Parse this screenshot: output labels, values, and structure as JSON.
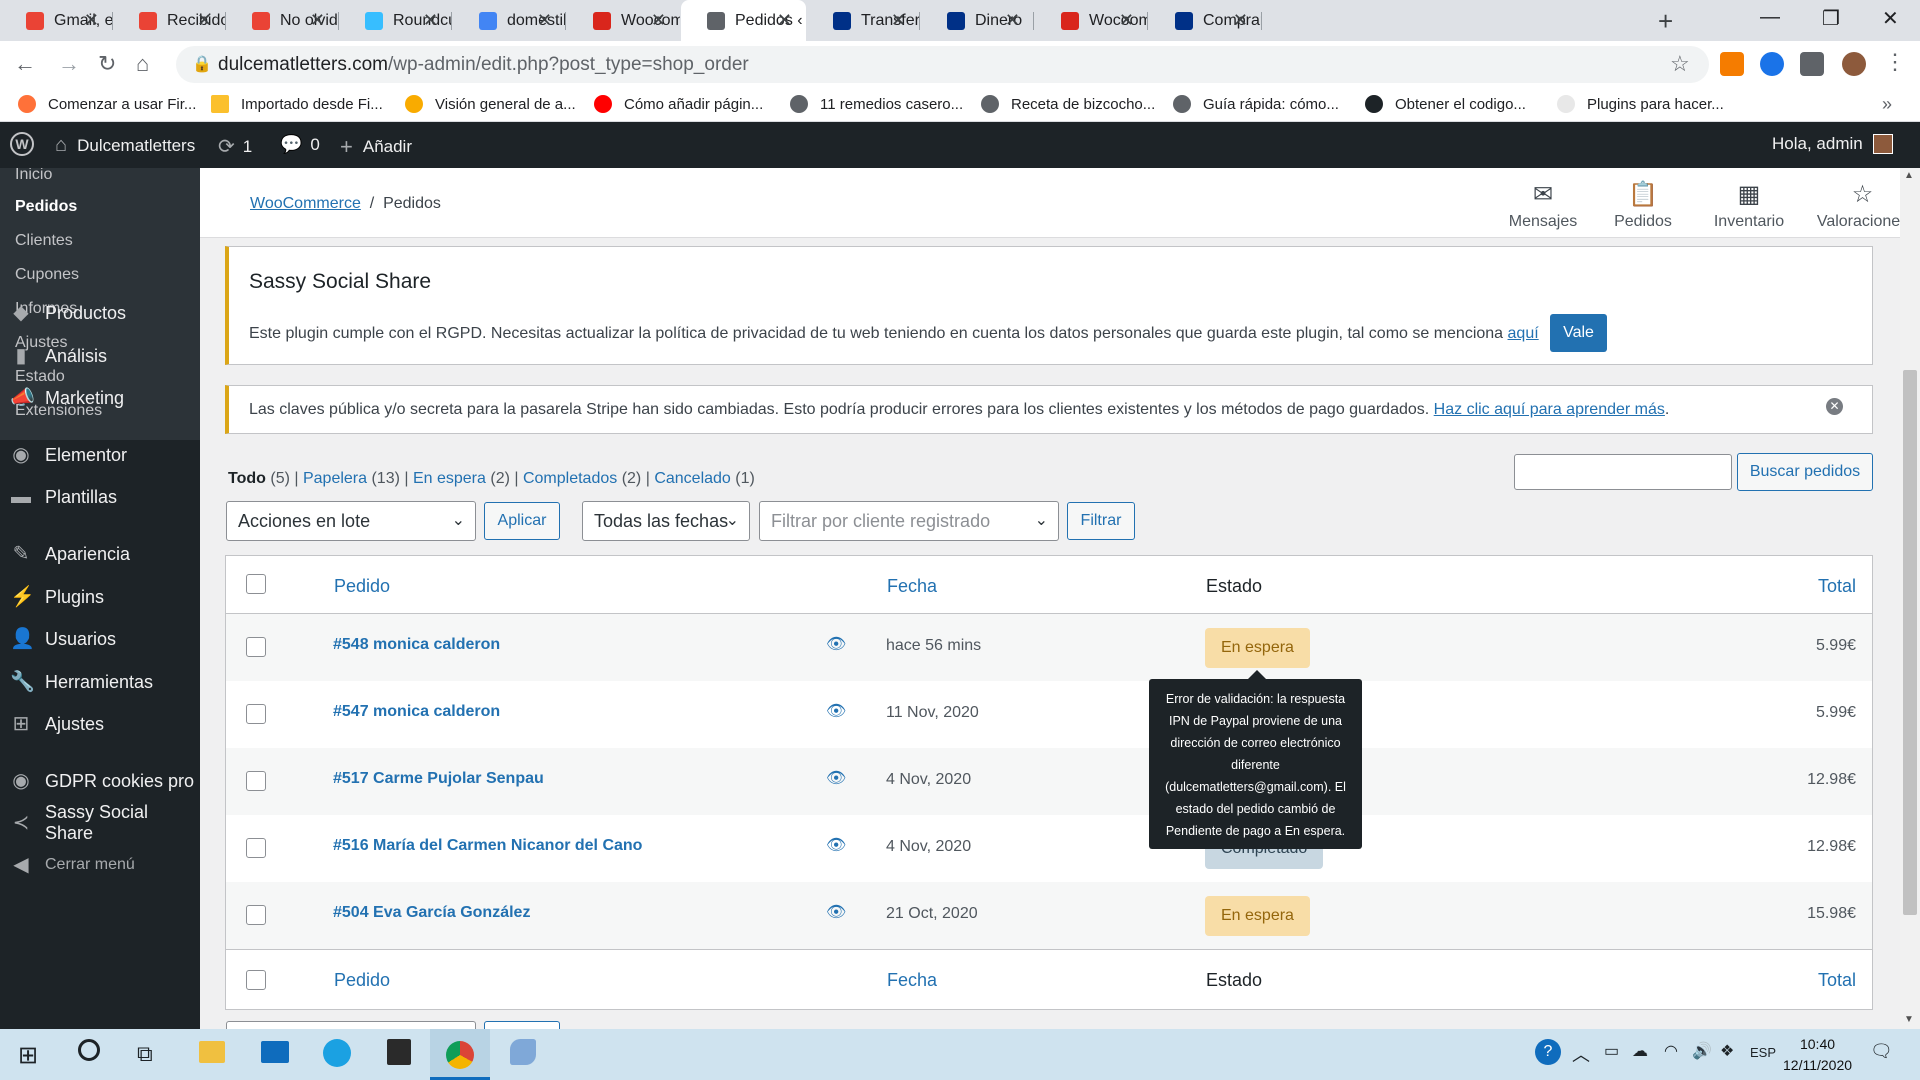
{
  "browser": {
    "tabs": [
      {
        "label": "Gmail, el c",
        "icon": "gmail-icon",
        "color": "#ea4335"
      },
      {
        "label": "Recibidos",
        "icon": "gmail-icon",
        "color": "#ea4335"
      },
      {
        "label": "No olvide",
        "icon": "gmail-icon",
        "color": "#ea4335"
      },
      {
        "label": "Roundcub",
        "icon": "roundcube-icon",
        "color": "#37beff"
      },
      {
        "label": "domestika",
        "icon": "google-icon",
        "color": "#4285f4"
      },
      {
        "label": "Woocomm",
        "icon": "woocommerce-icon",
        "color": "#d9261c"
      },
      {
        "label": "Pedidos ‹",
        "icon": "page-icon",
        "color": "#5f6368"
      },
      {
        "label": "Transferen",
        "icon": "paypal-icon",
        "color": "#003087"
      },
      {
        "label": "Dinero",
        "icon": "paypal-icon",
        "color": "#003087"
      },
      {
        "label": "Wocoome",
        "icon": "woocommerce-icon",
        "color": "#d9261c"
      },
      {
        "label": "Comprar, ",
        "icon": "paypal-icon",
        "color": "#003087"
      }
    ],
    "url_host": "dulcematletters.com",
    "url_path": "/wp-admin/edit.php?post_type=shop_order",
    "bookmarks": [
      {
        "label": "Comenzar a usar Fir...",
        "icon": "firefox-icon",
        "color": "#ff7139"
      },
      {
        "label": "Importado desde Fi...",
        "icon": "folder-icon",
        "color": "#fbc02d"
      },
      {
        "label": "Visión general de a...",
        "icon": "analytics-icon",
        "color": "#f9ab00"
      },
      {
        "label": "Cómo añadir págin...",
        "icon": "youtube-icon",
        "color": "#ff0000"
      },
      {
        "label": "11 remedios casero...",
        "icon": "globe-icon",
        "color": "#5f6368"
      },
      {
        "label": "Receta de bizcocho...",
        "icon": "globe-icon",
        "color": "#5f6368"
      },
      {
        "label": "Guía rápida: cómo...",
        "icon": "globe-icon",
        "color": "#5f6368"
      },
      {
        "label": "Obtener el codigo...",
        "icon": "mco-icon",
        "color": "#1d2327"
      },
      {
        "label": "Plugins para hacer...",
        "icon": "egg-icon",
        "color": "#e8e8e8"
      }
    ]
  },
  "adminbar": {
    "site": "Dulcematletters",
    "updates": "1",
    "comments": "0",
    "add": "Añadir",
    "greeting": "Hola, admin"
  },
  "sidebar": {
    "submenu": [
      "Inicio",
      "Pedidos",
      "Clientes",
      "Cupones",
      "Informes",
      "Ajustes",
      "Estado",
      "Extensiones"
    ],
    "menu": [
      {
        "label": "Productos",
        "icon": "products-icon"
      },
      {
        "label": "Análisis",
        "icon": "analytics-icon"
      },
      {
        "label": "Marketing",
        "icon": "megaphone-icon"
      },
      {
        "label": "Elementor",
        "icon": "elementor-icon"
      },
      {
        "label": "Plantillas",
        "icon": "folder-icon"
      },
      {
        "label": "Apariencia",
        "icon": "paintbrush-icon"
      },
      {
        "label": "Plugins",
        "icon": "plugin-icon"
      },
      {
        "label": "Usuarios",
        "icon": "users-icon"
      },
      {
        "label": "Herramientas",
        "icon": "wrench-icon"
      },
      {
        "label": "Ajustes",
        "icon": "settings-icon"
      },
      {
        "label": "GDPR cookies pro",
        "icon": "gdpr-icon"
      },
      {
        "label": "Sassy Social Share",
        "icon": "share-icon"
      },
      {
        "label": "Cerrar menú",
        "icon": "collapse-icon"
      }
    ]
  },
  "header": {
    "breadcrumb_link": "WooCommerce",
    "breadcrumb_current": "Pedidos",
    "actions": [
      "Mensajes",
      "Pedidos",
      "Inventario",
      "Valoraciones"
    ]
  },
  "notice_sassy": {
    "title": "Sassy Social Share",
    "text": "Este plugin cumple con el RGPD. Necesitas actualizar la política de privacidad de tu web teniendo en cuenta los datos personales que guarda este plugin, tal como se menciona",
    "link": "aquí",
    "button": "Vale"
  },
  "notice_stripe": {
    "text": "Las claves pública y/o secreta para la pasarela Stripe han sido cambiadas. Esto podría producir errores para los clientes existentes y los métodos de pago guardados.",
    "link": "Haz clic aquí para aprender más"
  },
  "views": [
    {
      "label": "Todo",
      "count": "(5)"
    },
    {
      "label": "Papelera",
      "count": "(13)"
    },
    {
      "label": "En espera",
      "count": "(2)"
    },
    {
      "label": "Completados",
      "count": "(2)"
    },
    {
      "label": "Cancelado",
      "count": "(1)"
    }
  ],
  "search_button": "Buscar pedidos",
  "bulk_actions": "Acciones en lote",
  "apply": "Aplicar",
  "all_dates": "Todas las fechas",
  "customer_filter_placeholder": "Filtrar por cliente registrado",
  "filter": "Filtrar",
  "table": {
    "columns": [
      "Pedido",
      "Fecha",
      "Estado",
      "Total"
    ],
    "rows": [
      {
        "order": "#548 monica calderon",
        "date": "hace 56 mins",
        "status": "En espera",
        "status_type": "hold",
        "total": "5.99€"
      },
      {
        "order": "#547 monica calderon",
        "date": "11 Nov, 2020",
        "status": "",
        "status_type": "",
        "total": "5.99€"
      },
      {
        "order": "#517 Carme Pujolar Senpau",
        "date": "4 Nov, 2020",
        "status": "",
        "status_type": "",
        "total": "12.98€"
      },
      {
        "order": "#516 María del Carmen Nicanor del Cano",
        "date": "4 Nov, 2020",
        "status": "Completado",
        "status_type": "done",
        "total": "12.98€"
      },
      {
        "order": "#504 Eva García González",
        "date": "21 Oct, 2020",
        "status": "En espera",
        "status_type": "hold",
        "total": "15.98€"
      }
    ]
  },
  "tooltip": "Error de validación: la respuesta IPN de Paypal proviene de una dirección de correo electrónico diferente (dulcematletters@gmail.com). El estado del pedido cambió de Pendiente de pago a En espera.",
  "taskbar": {
    "lang": "ESP",
    "time": "10:40",
    "date": "12/11/2020"
  }
}
